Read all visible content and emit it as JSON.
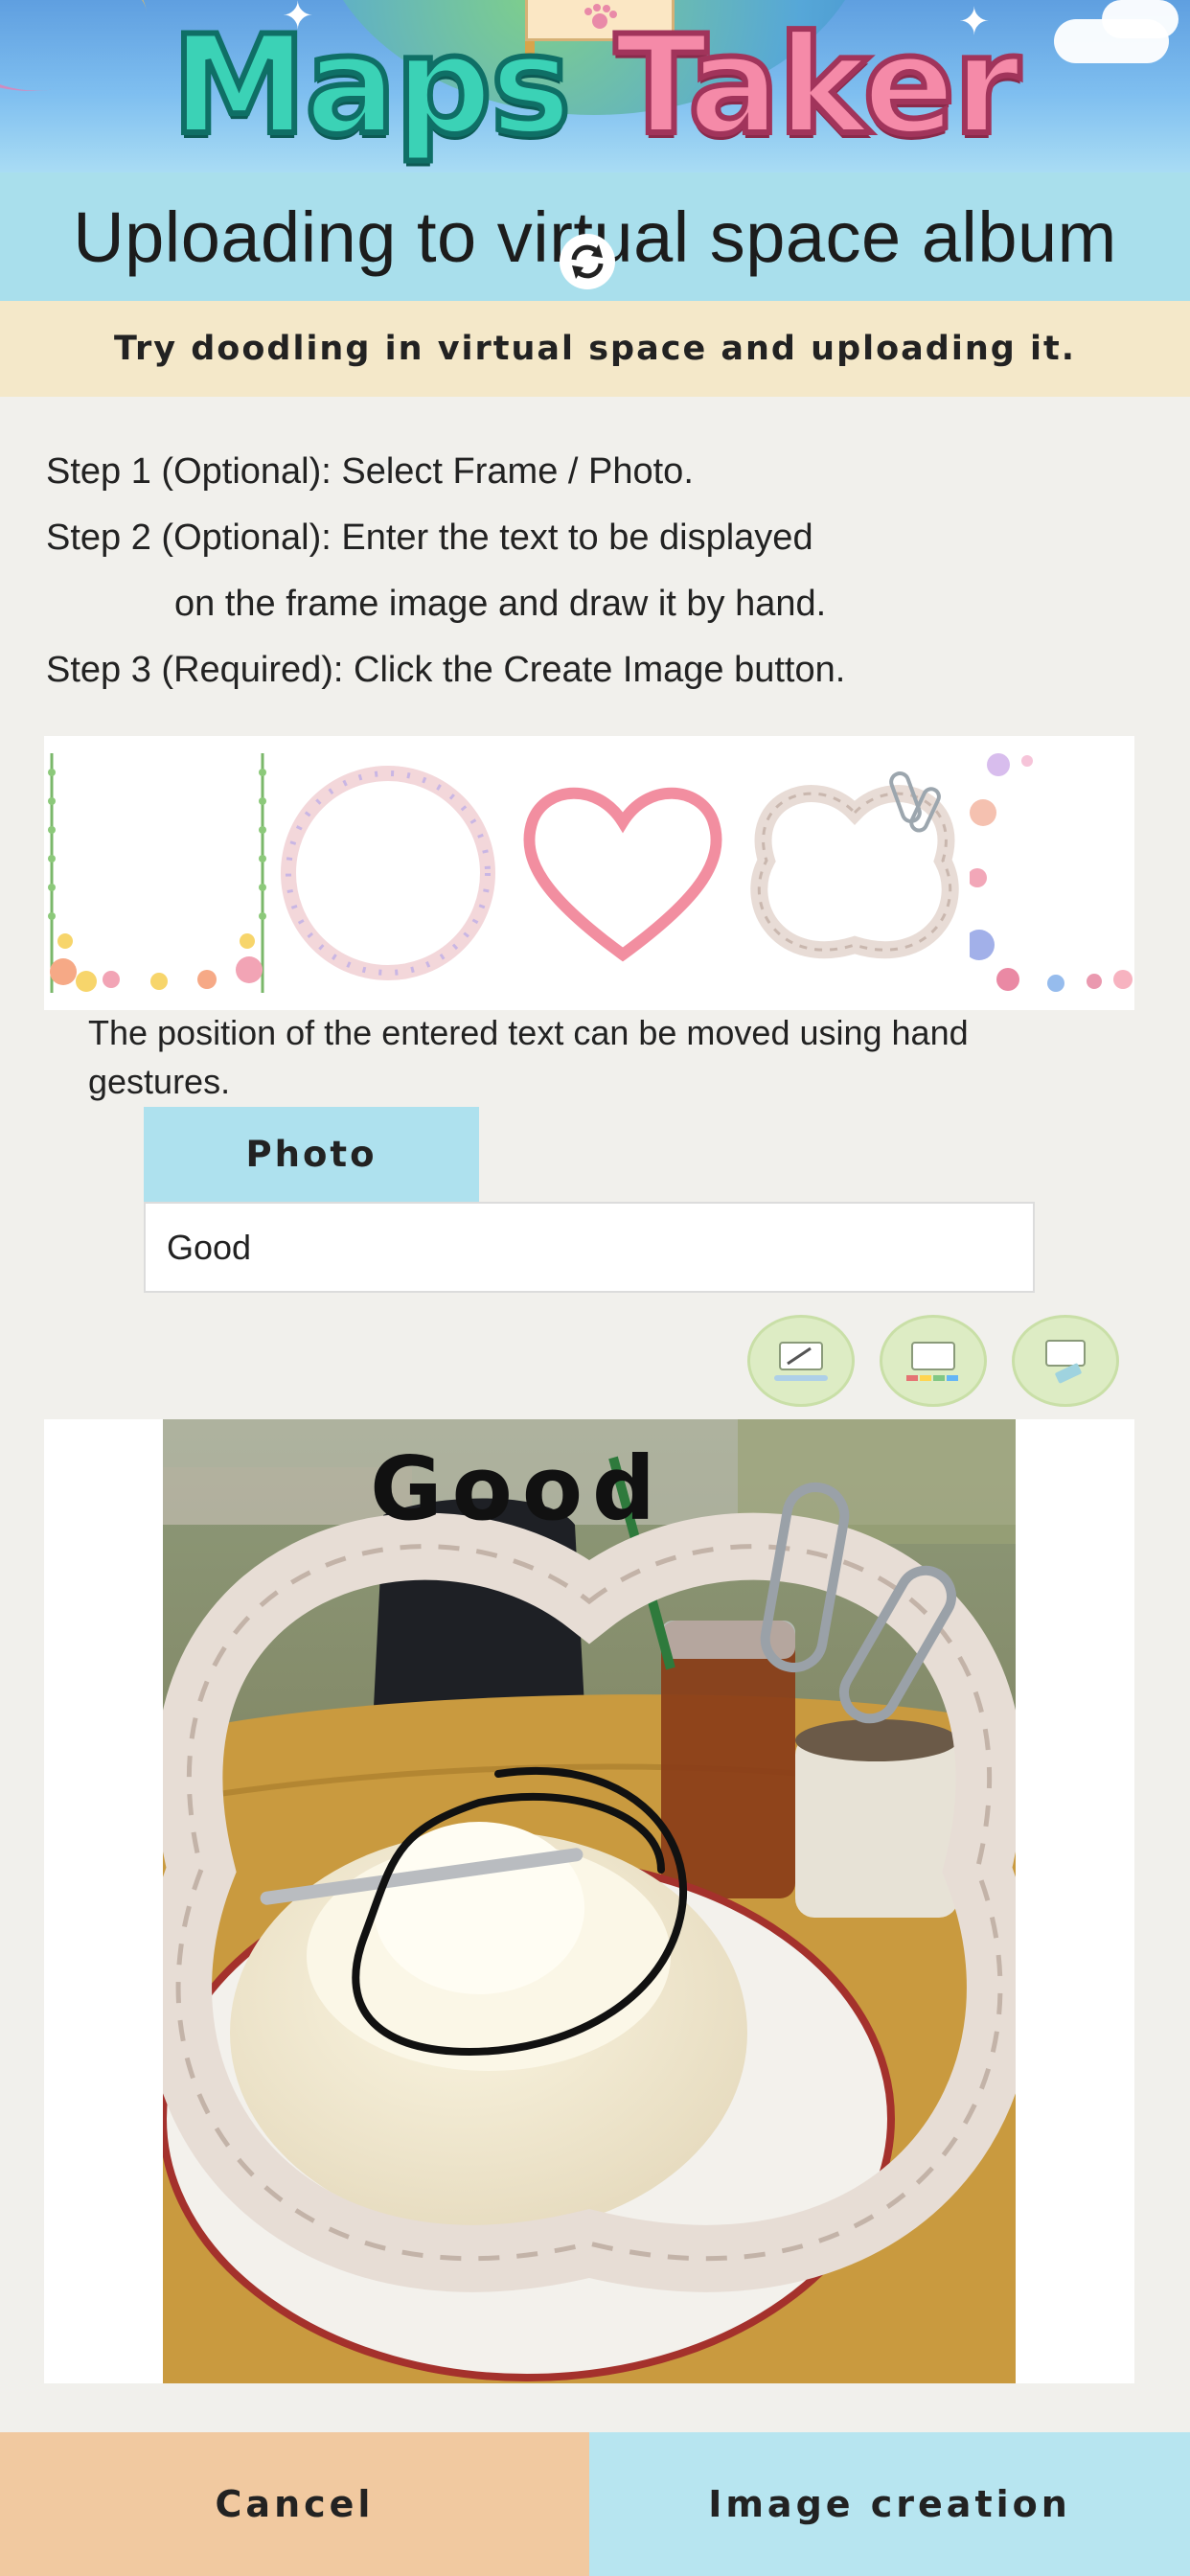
{
  "banner": {
    "logo_word1": "Maps",
    "logo_word2": "Taker"
  },
  "header": {
    "title": "Uploading to virtual space album"
  },
  "hint": "Try doodling in virtual space and uploading it.",
  "steps": {
    "step1": "Step 1 (Optional): Select Frame / Photo.",
    "step2_line1": "Step 2 (Optional): Enter the text to be displayed",
    "step2_line2": "on the frame image and draw it by hand.",
    "step3": "Step 3 (Required): Click the Create Image button."
  },
  "frames": [
    {
      "name": "flower-border-frame"
    },
    {
      "name": "dotted-circle-frame"
    },
    {
      "name": "pink-heart-frame"
    },
    {
      "name": "clover-clip-frame"
    },
    {
      "name": "watercolor-floral-frame"
    }
  ],
  "note": "The position of the entered text can be moved using hand gestures.",
  "photo_tab": {
    "label": "Photo"
  },
  "text_input": {
    "value": "Good"
  },
  "tools": [
    {
      "icon": "pen-draw-icon"
    },
    {
      "icon": "color-palette-icon"
    },
    {
      "icon": "eraser-icon"
    }
  ],
  "canvas": {
    "overlay_text": "Good"
  },
  "buttons": {
    "cancel": "Cancel",
    "create": "Image creation"
  },
  "colors": {
    "title_bar": "#a9dfec",
    "hint_bar": "#f4e8c9",
    "cancel_button": "#f1c9a0",
    "create_button": "#b7e5f0"
  }
}
